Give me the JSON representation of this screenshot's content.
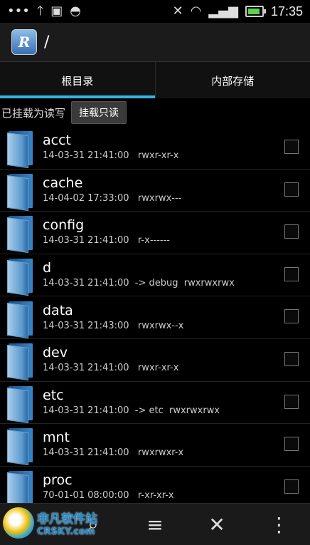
{
  "status_bar": {
    "time": "17:35",
    "battery_level": 0.9,
    "icons": [
      "more-dots-icon",
      "upload-arrow-icon",
      "image-icon",
      "android-icon",
      "mute-icon",
      "wifi-icon",
      "signal-icon",
      "battery-icon"
    ]
  },
  "action_bar": {
    "app_icon_letter": "R",
    "path": "/"
  },
  "tabs": [
    {
      "label": "根目录",
      "active": true
    },
    {
      "label": "内部存储",
      "active": false
    }
  ],
  "mount": {
    "status": "已挂载为读写",
    "button": "挂载只读"
  },
  "files": [
    {
      "name": "acct",
      "meta": "14-03-31 21:41:00   rwxr-xr-x"
    },
    {
      "name": "cache",
      "meta": "14-04-02 17:33:00   rwxrwx---"
    },
    {
      "name": "config",
      "meta": "14-03-31 21:41:00   r-x------"
    },
    {
      "name": "d",
      "meta": "14-03-31 21:41:00  -> debug  rwxrwxrwx"
    },
    {
      "name": "data",
      "meta": "14-03-31 21:43:00   rwxrwx--x"
    },
    {
      "name": "dev",
      "meta": "14-03-31 21:41:00   rwxr-xr-x"
    },
    {
      "name": "etc",
      "meta": "14-03-31 21:41:00  -> etc  rwxrwxrwx"
    },
    {
      "name": "mnt",
      "meta": "14-03-31 21:41:00   rwxrwxr-x"
    },
    {
      "name": "proc",
      "meta": "70-01-01 08:00:00   r-xr-xr-x"
    }
  ],
  "watermark": {
    "cn": "非凡软件站",
    "en": "CRSKY.com"
  },
  "colors": {
    "accent": "#33b5e5",
    "background": "#000000"
  }
}
